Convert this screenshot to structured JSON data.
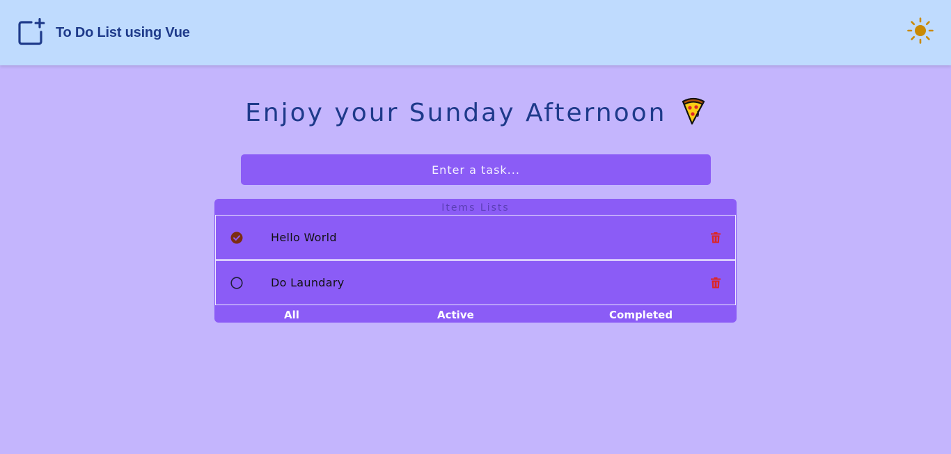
{
  "header": {
    "title": "To Do List using Vue",
    "app_icon": "add-box-icon",
    "theme_icon": "sun-icon"
  },
  "greeting": {
    "text": "Enjoy your Sunday Afternoon",
    "emoji_icon": "pizza-icon"
  },
  "task_input": {
    "value": "",
    "placeholder": "Enter a task..."
  },
  "list": {
    "heading": "Items Lists",
    "items": [
      {
        "label": "Hello World",
        "completed": true
      },
      {
        "label": "Do Laundary",
        "completed": false
      }
    ],
    "filters": [
      {
        "label": "All"
      },
      {
        "label": "Active"
      },
      {
        "label": "Completed"
      }
    ]
  },
  "colors": {
    "page_background": "#c4b5fd",
    "header_background": "#bfdbfe",
    "accent": "#8b5cf6",
    "title_text": "#1e3a8a",
    "sun": "#ca8a04",
    "delete": "#dc2626",
    "check": "#7c2d12"
  }
}
